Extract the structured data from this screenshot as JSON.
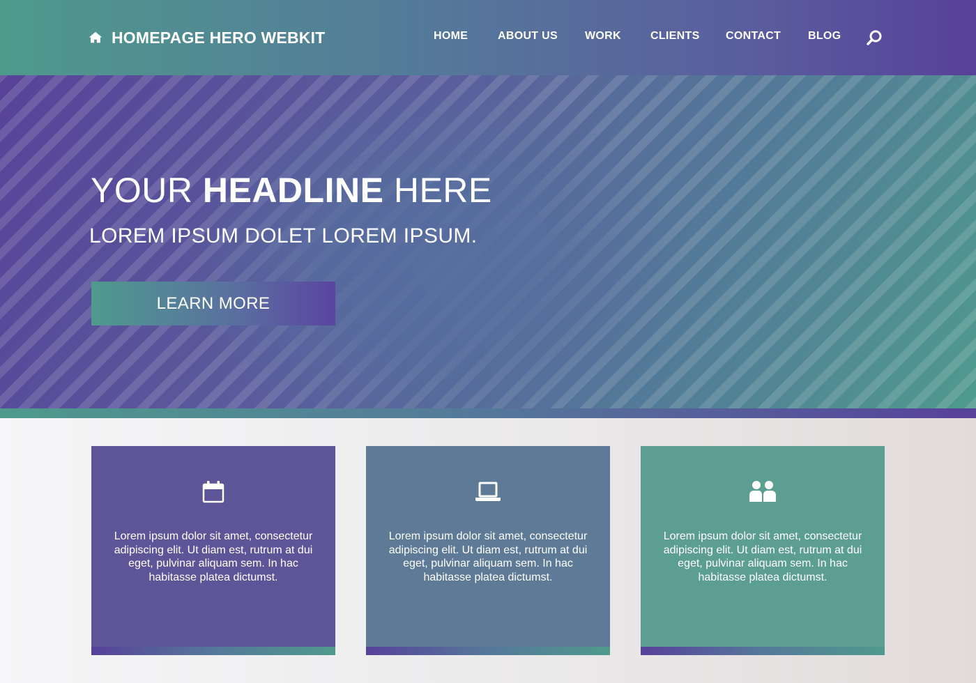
{
  "header": {
    "brand_name": "HOMEPAGE HERO WEBKIT",
    "brand_icon": "home-icon",
    "nav": [
      {
        "label": "HOME"
      },
      {
        "label": "ABOUT US"
      },
      {
        "label": "WORK"
      },
      {
        "label": "CLIENTS"
      },
      {
        "label": "CONTACT"
      },
      {
        "label": "BLOG"
      }
    ],
    "search_icon": "search-icon"
  },
  "hero": {
    "headline_pre": "YOUR ",
    "headline_bold": "HEADLINE",
    "headline_post": " HERE",
    "subheadline": "LOREM IPSUM DOLET LOREM IPSUM.",
    "cta_label": "LEARN MORE"
  },
  "features": [
    {
      "icon": "calendar-icon",
      "text": "Lorem ipsum dolor sit amet, consectetur adipiscing elit. Ut diam est, rutrum at dui eget, pulvinar aliquam sem. In hac habitasse platea dictumst."
    },
    {
      "icon": "laptop-icon",
      "text": "Lorem ipsum dolor sit amet, consectetur adipiscing elit. Ut diam est, rutrum at dui eget, pulvinar aliquam sem. In hac habitasse platea dictumst."
    },
    {
      "icon": "users-icon",
      "text": "Lorem ipsum dolor sit amet, consectetur adipiscing elit. Ut diam est, rutrum at dui eget, pulvinar aliquam sem. In hac habitasse platea dictumst."
    }
  ],
  "colors": {
    "teal": "#4f9a8c",
    "slate_blue": "#5e7a96",
    "purple": "#57419a",
    "card_purple": "#5e5498",
    "card_teal": "#5c9e92",
    "text_white": "#ffffff"
  }
}
